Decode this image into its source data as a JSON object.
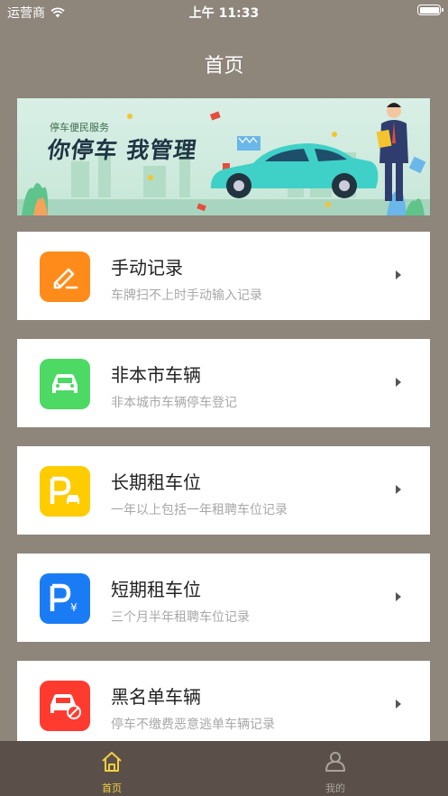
{
  "status_bar": {
    "carrier": "运营商",
    "time": "上午 11:33"
  },
  "nav": {
    "title": "首页"
  },
  "banner": {
    "subtitle": "停车便民服务",
    "title": "你停车 我管理"
  },
  "menu": [
    {
      "title": "手动记录",
      "desc": "车牌扫不上时手动输入记录",
      "color": "#ff8c1a",
      "icon": "edit-icon"
    },
    {
      "title": "非本市车辆",
      "desc": "非本城市车辆停车登记",
      "color": "#4cd964",
      "icon": "car-icon"
    },
    {
      "title": "长期租车位",
      "desc": "一年以上包括一年租聘车位记录",
      "color": "#ffcc00",
      "icon": "parking-car-icon"
    },
    {
      "title": "短期租车位",
      "desc": "三个月半年租聘车位记录",
      "color": "#1a7cf5",
      "icon": "parking-yen-icon"
    },
    {
      "title": "黑名单车辆",
      "desc": "停车不缴费恶意逃单车辆记录",
      "color": "#ff3b30",
      "icon": "blocked-car-icon"
    }
  ],
  "tabs": [
    {
      "label": "首页",
      "active": true,
      "color": "#f4d03f",
      "icon": "home-icon"
    },
    {
      "label": "我的",
      "active": false,
      "color": "#aaa39c",
      "icon": "user-icon"
    }
  ]
}
